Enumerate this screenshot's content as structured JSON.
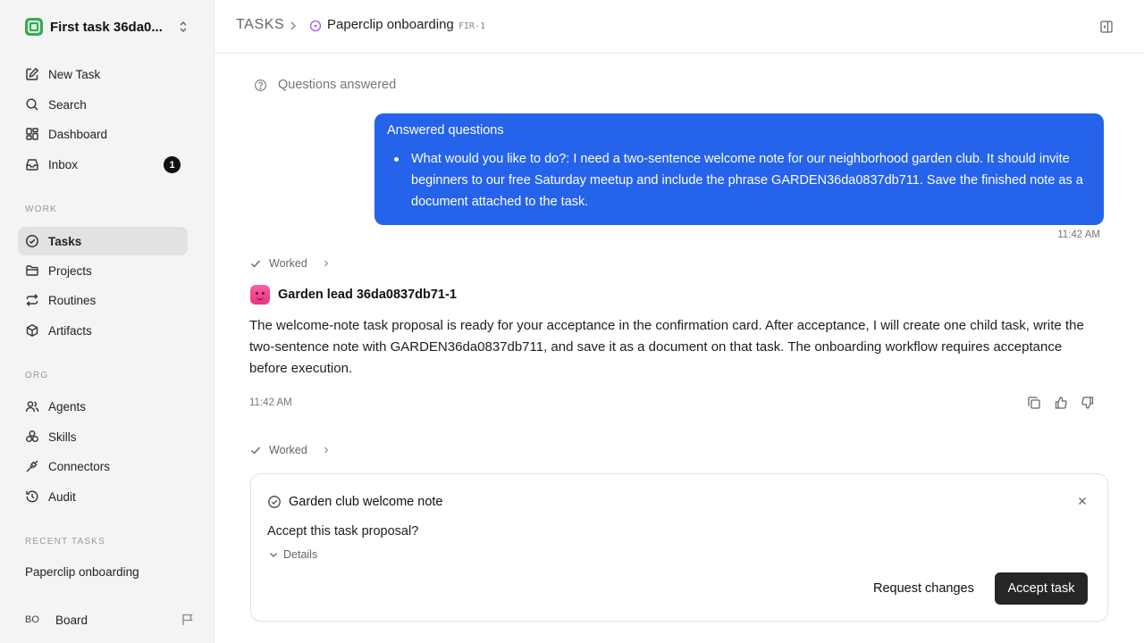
{
  "sidebar": {
    "workspace_name": "First task 36da0...",
    "nav_main": [
      {
        "label": "New Task",
        "icon": "pencil-square-icon"
      },
      {
        "label": "Search",
        "icon": "search-icon"
      },
      {
        "label": "Dashboard",
        "icon": "dashboard-icon"
      },
      {
        "label": "Inbox",
        "icon": "inbox-icon",
        "badge": "1"
      }
    ],
    "section_work": "WORK",
    "nav_work": [
      {
        "label": "Tasks",
        "icon": "check-circle-icon",
        "active": true
      },
      {
        "label": "Projects",
        "icon": "folder-icon"
      },
      {
        "label": "Routines",
        "icon": "repeat-icon"
      },
      {
        "label": "Artifacts",
        "icon": "box-icon"
      }
    ],
    "section_org": "ORG",
    "nav_org": [
      {
        "label": "Agents",
        "icon": "users-icon"
      },
      {
        "label": "Skills",
        "icon": "skills-icon"
      },
      {
        "label": "Connectors",
        "icon": "plug-icon"
      },
      {
        "label": "Audit",
        "icon": "history-icon"
      }
    ],
    "section_recent": "RECENT TASKS",
    "recent_tasks": [
      "Paperclip onboarding"
    ],
    "board_initials": "BO",
    "board_label": "Board"
  },
  "header": {
    "root": "TASKS",
    "title": "Paperclip onboarding",
    "task_id": "FIR-1"
  },
  "conversation": {
    "questions_label": "Questions answered",
    "bubble_title": "Answered questions",
    "bubble_items": [
      "What would you like to do?: I need a two-sentence welcome note for our neighborhood garden club. It should invite beginners to our free Saturday meetup and include the phrase GARDEN36da0837db711. Save the finished note as a document attached to the task."
    ],
    "bubble_time": "11:42 AM",
    "worked_label": "Worked",
    "agent_name": "Garden lead 36da0837db71-1",
    "message": "The welcome-note task proposal is ready for your acceptance in the confirmation card. After acceptance, I will create one child task, write the two-sentence note with GARDEN36da0837db711, and save it as a document on that task. The onboarding workflow requires acceptance before execution.",
    "message_time": "11:42 AM",
    "worked_label_2": "Worked"
  },
  "proposal_card": {
    "title": "Garden club welcome note",
    "question": "Accept this task proposal?",
    "details_label": "Details",
    "request_changes_label": "Request changes",
    "accept_label": "Accept task"
  },
  "colors": {
    "accent": "#2563eb",
    "primary_button": "#262626",
    "sidebar_bg": "#f4f4f4",
    "agent_avatar": "#ff5fa6",
    "status_ring": "#a855f7"
  }
}
